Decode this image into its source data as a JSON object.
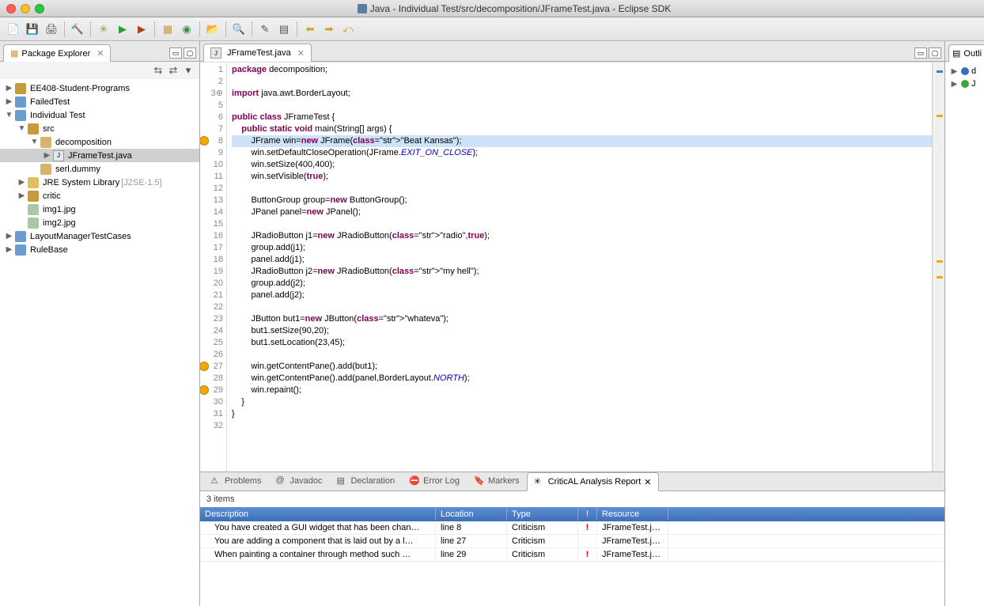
{
  "window": {
    "title": "Java - Individual Test/src/decomposition/JFrameTest.java - Eclipse SDK"
  },
  "package_explorer": {
    "title": "Package Explorer",
    "projects": [
      "EE408-Student-Programs",
      "FailedTest",
      "Individual Test",
      "LayoutManagerTestCases",
      "RuleBase"
    ],
    "open_src_label": "src",
    "pkg_decomp": "decomposition",
    "pkg_serl": "serl.dummy",
    "jfile": "JFrameTest.java",
    "jre": "JRE System Library",
    "jre_ver": "[J2SE-1.5]",
    "critic": "critic",
    "img1": "img1.jpg",
    "img2": "img2.jpg"
  },
  "editor": {
    "tab": "JFrameTest.java",
    "highlight_line": 8,
    "lines": [
      {
        "n": 1,
        "plain": "package decomposition;"
      },
      {
        "n": 2,
        "plain": ""
      },
      {
        "n": 3,
        "marker": "plus",
        "plain": "import java.awt.BorderLayout;"
      },
      {
        "n": 5,
        "plain": ""
      },
      {
        "n": 6,
        "plain": "public class JFrameTest {"
      },
      {
        "n": 7,
        "plain": "    public static void main(String[] args) {"
      },
      {
        "n": 8,
        "marker": "warn",
        "plain": "        JFrame win=new JFrame(\"Beat Kansas\");"
      },
      {
        "n": 9,
        "plain": "        win.setDefaultCloseOperation(JFrame.EXIT_ON_CLOSE);"
      },
      {
        "n": 10,
        "plain": "        win.setSize(400,400);"
      },
      {
        "n": 11,
        "plain": "        win.setVisible(true);"
      },
      {
        "n": 12,
        "plain": ""
      },
      {
        "n": 13,
        "plain": "        ButtonGroup group=new ButtonGroup();"
      },
      {
        "n": 14,
        "plain": "        JPanel panel=new JPanel();"
      },
      {
        "n": 15,
        "plain": ""
      },
      {
        "n": 16,
        "plain": "        JRadioButton j1=new JRadioButton(\"radio\",true);"
      },
      {
        "n": 17,
        "plain": "        group.add(j1);"
      },
      {
        "n": 18,
        "plain": "        panel.add(j1);"
      },
      {
        "n": 19,
        "plain": "        JRadioButton j2=new JRadioButton(\"my hell\");"
      },
      {
        "n": 20,
        "plain": "        group.add(j2);"
      },
      {
        "n": 21,
        "plain": "        panel.add(j2);"
      },
      {
        "n": 22,
        "plain": ""
      },
      {
        "n": 23,
        "plain": "        JButton but1=new JButton(\"whateva\");"
      },
      {
        "n": 24,
        "plain": "        but1.setSize(90,20);"
      },
      {
        "n": 25,
        "plain": "        but1.setLocation(23,45);"
      },
      {
        "n": 26,
        "plain": ""
      },
      {
        "n": 27,
        "marker": "warn",
        "plain": "        win.getContentPane().add(but1);"
      },
      {
        "n": 28,
        "plain": "        win.getContentPane().add(panel,BorderLayout.NORTH);"
      },
      {
        "n": 29,
        "marker": "warn",
        "plain": "        win.repaint();"
      },
      {
        "n": 30,
        "plain": "    }"
      },
      {
        "n": 31,
        "plain": "}"
      },
      {
        "n": 32,
        "plain": ""
      }
    ]
  },
  "outline": {
    "title": "Outli",
    "items": [
      "d",
      "J"
    ]
  },
  "bottom": {
    "tabs": [
      "Problems",
      "Javadoc",
      "Declaration",
      "Error Log",
      "Markers",
      "CriticAL Analysis Report"
    ],
    "active": 5,
    "count": "3 items",
    "columns": [
      "Description",
      "Location",
      "Type",
      "!",
      "Resource"
    ],
    "rows": [
      {
        "desc": "You have created a GUI widget that has been chan…",
        "loc": "line 8",
        "type": "Criticism",
        "bang": "!",
        "res": "JFrameTest.java"
      },
      {
        "desc": "You are adding a component that is laid out by a l…",
        "loc": "line 27",
        "type": "Criticism",
        "bang": "",
        "res": "JFrameTest.java"
      },
      {
        "desc": "When painting a container through method such …",
        "loc": "line 29",
        "type": "Criticism",
        "bang": "!",
        "res": "JFrameTest.java"
      }
    ]
  }
}
